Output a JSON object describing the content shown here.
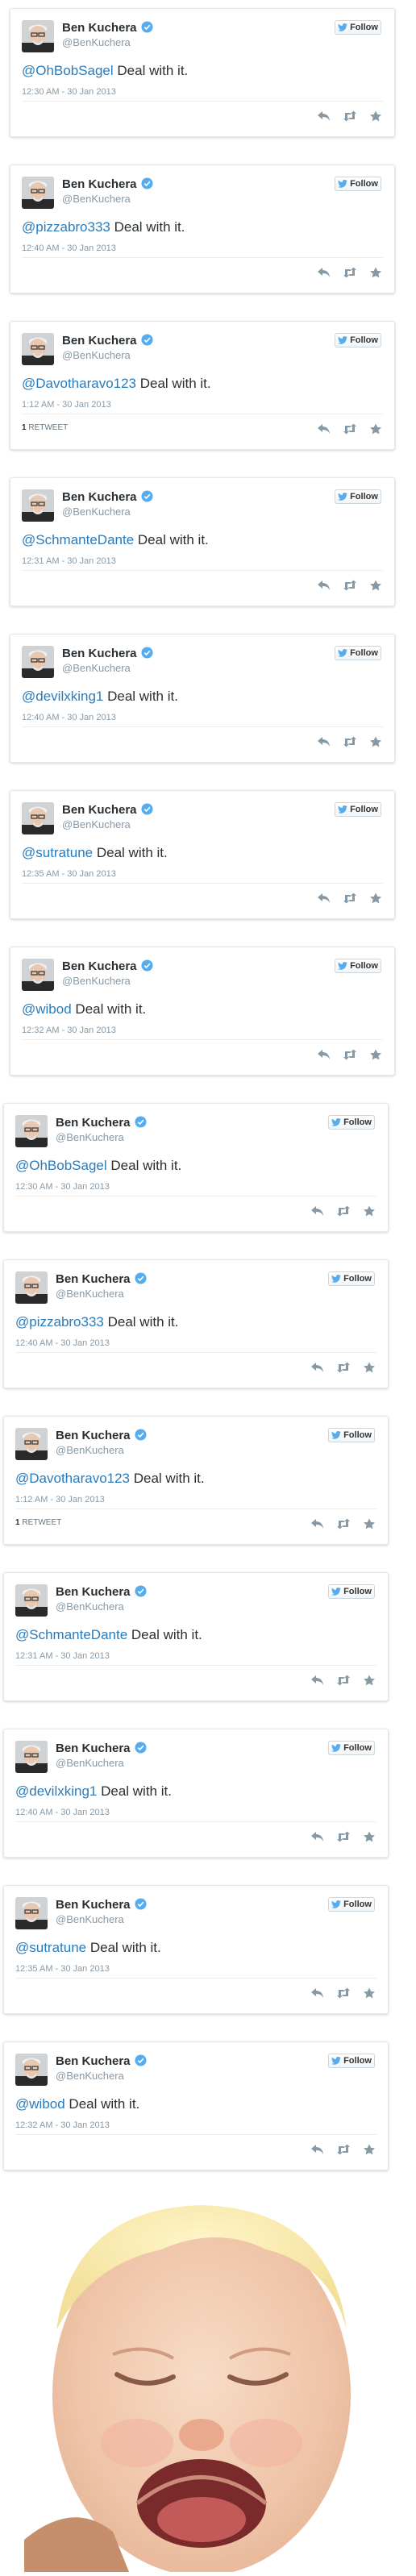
{
  "tweets": [
    {
      "name": "Ben Kuchera",
      "handle": "@BenKuchera",
      "mention": "@OhBobSagel",
      "text": " Deal with it.",
      "time": "12:30 AM - 30 Jan 2013",
      "follow_label": "Follow",
      "retweet_count": "",
      "retweet_label": ""
    },
    {
      "name": "Ben Kuchera",
      "handle": "@BenKuchera",
      "mention": "@pizzabro333",
      "text": " Deal with it.",
      "time": "12:40 AM - 30 Jan 2013",
      "follow_label": "Follow",
      "retweet_count": "",
      "retweet_label": ""
    },
    {
      "name": "Ben Kuchera",
      "handle": "@BenKuchera",
      "mention": "@Davotharavo123",
      "text": " Deal with it.",
      "time": "1:12 AM - 30 Jan 2013",
      "follow_label": "Follow",
      "retweet_count": "1",
      "retweet_label": " RETWEET"
    },
    {
      "name": "Ben Kuchera",
      "handle": "@BenKuchera",
      "mention": "@SchmanteDante",
      "text": " Deal with it.",
      "time": "12:31 AM - 30 Jan 2013",
      "follow_label": "Follow",
      "retweet_count": "",
      "retweet_label": ""
    },
    {
      "name": "Ben Kuchera",
      "handle": "@BenKuchera",
      "mention": "@devilxking1",
      "text": " Deal with it.",
      "time": "12:40 AM - 30 Jan 2013",
      "follow_label": "Follow",
      "retweet_count": "",
      "retweet_label": ""
    },
    {
      "name": "Ben Kuchera",
      "handle": "@BenKuchera",
      "mention": "@sutratune",
      "text": " Deal with it.",
      "time": "12:35 AM - 30 Jan 2013",
      "follow_label": "Follow",
      "retweet_count": "",
      "retweet_label": ""
    },
    {
      "name": "Ben Kuchera",
      "handle": "@BenKuchera",
      "mention": "@wibod",
      "text": " Deal with it.",
      "time": "12:32 AM - 30 Jan 2013",
      "follow_label": "Follow",
      "retweet_count": "",
      "retweet_label": ""
    },
    {
      "name": "Ben Kuchera",
      "handle": "@BenKuchera",
      "mention": "@OhBobSagel",
      "text": " Deal with it.",
      "time": "12:30 AM - 30 Jan 2013",
      "follow_label": "Follow",
      "retweet_count": "",
      "retweet_label": ""
    },
    {
      "name": "Ben Kuchera",
      "handle": "@BenKuchera",
      "mention": "@pizzabro333",
      "text": " Deal with it.",
      "time": "12:40 AM - 30 Jan 2013",
      "follow_label": "Follow",
      "retweet_count": "",
      "retweet_label": ""
    },
    {
      "name": "Ben Kuchera",
      "handle": "@BenKuchera",
      "mention": "@Davotharavo123",
      "text": " Deal with it.",
      "time": "1:12 AM - 30 Jan 2013",
      "follow_label": "Follow",
      "retweet_count": "1",
      "retweet_label": " RETWEET"
    },
    {
      "name": "Ben Kuchera",
      "handle": "@BenKuchera",
      "mention": "@SchmanteDante",
      "text": " Deal with it.",
      "time": "12:31 AM - 30 Jan 2013",
      "follow_label": "Follow",
      "retweet_count": "",
      "retweet_label": ""
    },
    {
      "name": "Ben Kuchera",
      "handle": "@BenKuchera",
      "mention": "@devilxking1",
      "text": " Deal with it.",
      "time": "12:40 AM - 30 Jan 2013",
      "follow_label": "Follow",
      "retweet_count": "",
      "retweet_label": ""
    },
    {
      "name": "Ben Kuchera",
      "handle": "@BenKuchera",
      "mention": "@sutratune",
      "text": " Deal with it.",
      "time": "12:35 AM - 30 Jan 2013",
      "follow_label": "Follow",
      "retweet_count": "",
      "retweet_label": ""
    },
    {
      "name": "Ben Kuchera",
      "handle": "@BenKuchera",
      "mention": "@wibod",
      "text": " Deal with it.",
      "time": "12:32 AM - 30 Jan 2013",
      "follow_label": "Follow",
      "retweet_count": "",
      "retweet_label": ""
    }
  ],
  "icons": {
    "verified": "verified-badge-icon",
    "bird": "twitter-bird-icon",
    "reply": "reply-icon",
    "retweet": "retweet-icon",
    "favorite": "star-icon"
  },
  "colors": {
    "mention": "#2b7bb9",
    "verified": "#55acee",
    "bird": "#55acee",
    "action": "#8899a6"
  }
}
